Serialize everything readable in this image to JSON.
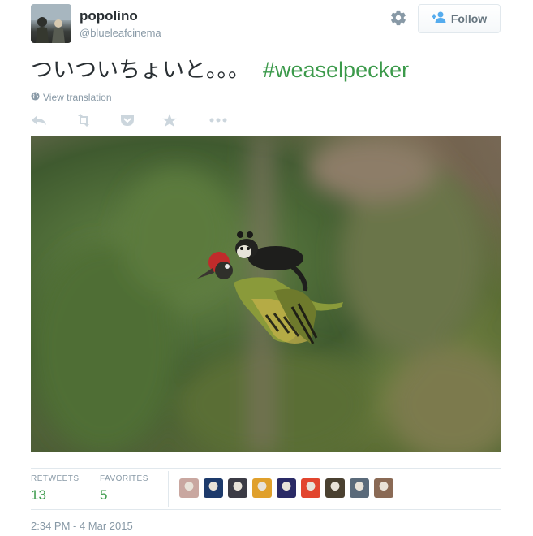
{
  "user": {
    "fullname": "popolino",
    "screen_name": "@blueleafcinema",
    "follow_label": "Follow"
  },
  "tweet": {
    "text": "ついついちょいと。。。",
    "hashtag": "#weaselpecker",
    "view_translation": "View translation"
  },
  "stats": {
    "retweets_label": "RETWEETS",
    "retweets_count": "13",
    "favorites_label": "FAVORITES",
    "favorites_count": "5"
  },
  "timestamp": "2:34 PM - 4 Mar 2015",
  "icons": {
    "settings": "gear-icon",
    "follow": "add-user-icon",
    "translate": "globe-icon",
    "reply": "reply-icon",
    "retweet": "retweet-icon",
    "favorite_alt": "pocket-icon",
    "favorite": "star-icon",
    "more": "more-icon"
  },
  "colors": {
    "hashtag": "#3c9a4b",
    "muted": "#8899a6",
    "icon": "#ccd6dd"
  },
  "favoriters": [
    {
      "name": "favoriter-1",
      "color": "#c9a7a0"
    },
    {
      "name": "favoriter-2",
      "color": "#1d3a6b"
    },
    {
      "name": "favoriter-3",
      "color": "#3b3b45"
    },
    {
      "name": "favoriter-4",
      "color": "#e0a02c"
    },
    {
      "name": "favoriter-5",
      "color": "#2a2a66"
    },
    {
      "name": "favoriter-6",
      "color": "#e2452e"
    },
    {
      "name": "favoriter-7",
      "color": "#4a4030"
    },
    {
      "name": "favoriter-8",
      "color": "#5a6a7a"
    },
    {
      "name": "favoriter-9",
      "color": "#8a6a55"
    }
  ]
}
